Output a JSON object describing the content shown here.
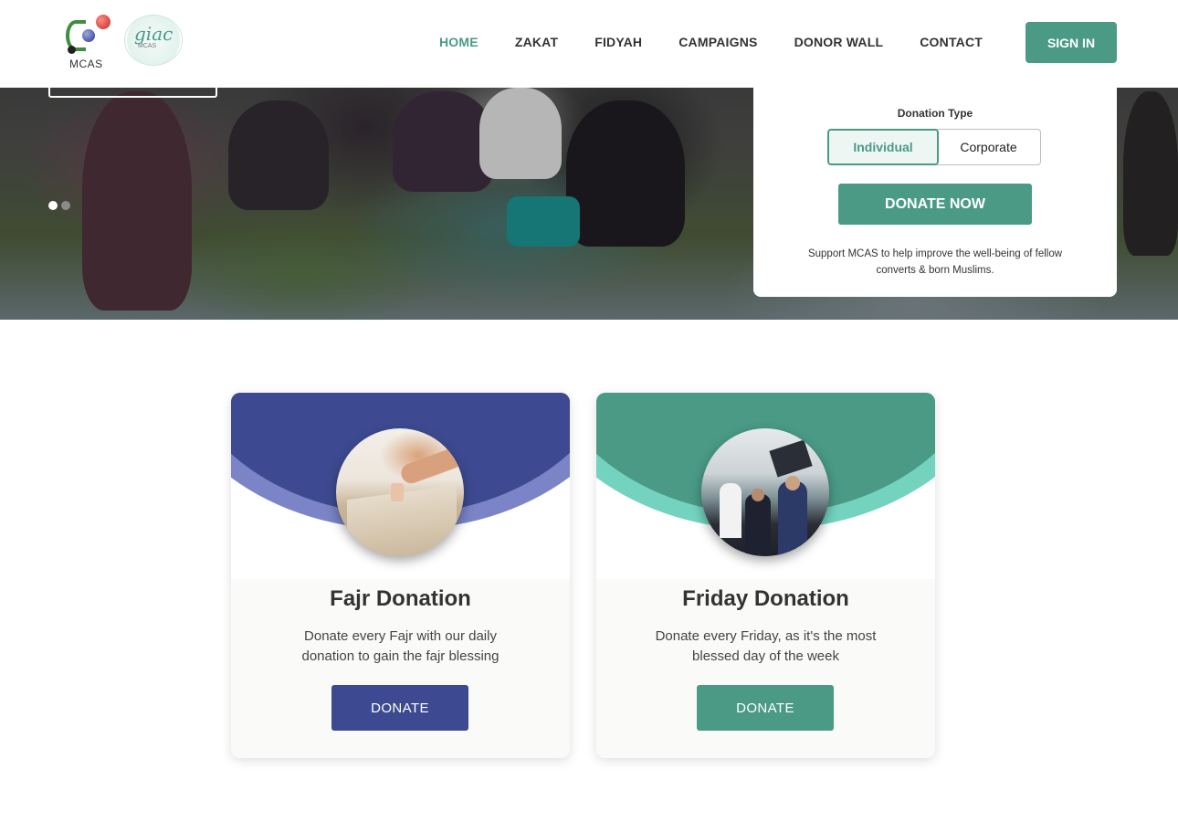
{
  "brand": {
    "logo_text": "MCAS",
    "partner_logo_text": "giac",
    "partner_logo_sub": "MCAS"
  },
  "nav": {
    "items": [
      {
        "label": "HOME",
        "active": true
      },
      {
        "label": "ZAKAT",
        "active": false
      },
      {
        "label": "FIDYAH",
        "active": false
      },
      {
        "label": "CAMPAIGNS",
        "active": false
      },
      {
        "label": "DONOR WALL",
        "active": false
      },
      {
        "label": "CONTACT",
        "active": false
      }
    ],
    "signin_label": "SIGN IN"
  },
  "hero": {
    "slides_total": 2,
    "active_slide": 1
  },
  "donation_panel": {
    "type_label": "Donation Type",
    "options": [
      "Individual",
      "Corporate"
    ],
    "selected": "Individual",
    "donate_now_label": "DONATE NOW",
    "note": "Support MCAS to help improve the well-being of fellow converts & born Muslims."
  },
  "cards": [
    {
      "title": "Fajr Donation",
      "description": "Donate every Fajr with our daily donation to gain the fajr blessing",
      "button_label": "DONATE",
      "accent": "#3d4a91",
      "accent_light": "#7a84c6"
    },
    {
      "title": "Friday Donation",
      "description": "Donate every Friday, as it's the most blessed day of the week",
      "button_label": "DONATE",
      "accent": "#4a9a86",
      "accent_light": "#74d3bf"
    }
  ],
  "colors": {
    "primary": "#4a9a86",
    "nav_active": "#4a9a8a",
    "fajr": "#3d4a91"
  }
}
